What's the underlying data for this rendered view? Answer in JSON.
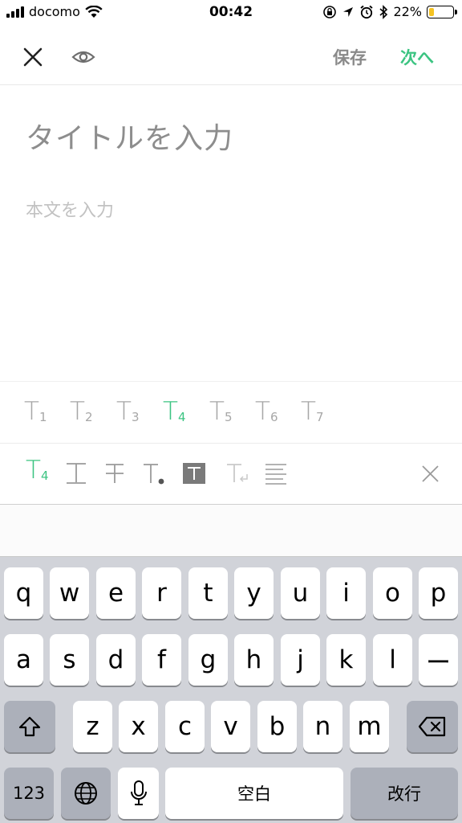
{
  "status_bar": {
    "carrier": "docomo",
    "time": "00:42",
    "battery_percent": "22%",
    "battery_level": 0.22,
    "battery_color": "#f5c322"
  },
  "nav": {
    "close_icon": "close-icon",
    "preview_icon": "eye-icon",
    "save_label": "保存",
    "next_label": "次へ",
    "accent_color": "#3cc482"
  },
  "editor": {
    "title_placeholder": "タイトルを入力",
    "body_placeholder": "本文を入力"
  },
  "heading_toolbar": {
    "items": [
      {
        "glyph": "T",
        "sub": "1"
      },
      {
        "glyph": "T",
        "sub": "2"
      },
      {
        "glyph": "T",
        "sub": "3"
      },
      {
        "glyph": "T",
        "sub": "4",
        "active": true
      },
      {
        "glyph": "T",
        "sub": "5"
      },
      {
        "glyph": "T",
        "sub": "6"
      },
      {
        "glyph": "T",
        "sub": "7"
      }
    ]
  },
  "format_toolbar": {
    "heading": {
      "glyph": "T",
      "sub": "4"
    },
    "icons": [
      "heading-icon",
      "underline-icon",
      "strikethrough-icon",
      "bullet-icon",
      "highlight-icon",
      "clear-format-icon",
      "align-icon",
      "close-icon"
    ]
  },
  "keyboard": {
    "row1": [
      "q",
      "w",
      "e",
      "r",
      "t",
      "y",
      "u",
      "i",
      "o",
      "p"
    ],
    "row2": [
      "a",
      "s",
      "d",
      "f",
      "g",
      "h",
      "j",
      "k",
      "l",
      "ー"
    ],
    "row3": [
      "z",
      "x",
      "c",
      "v",
      "b",
      "n",
      "m"
    ],
    "numbers_label": "123",
    "space_label": "空白",
    "return_label": "改行"
  }
}
